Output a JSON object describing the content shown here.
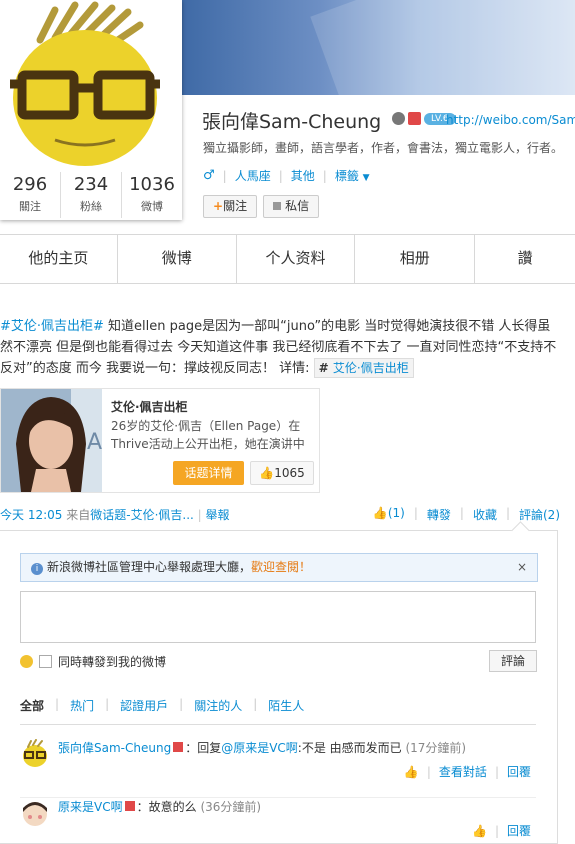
{
  "profile": {
    "name": "張向偉Sam-Cheung",
    "level": "LV.6",
    "url": "http://weibo.com/Sam",
    "bio": "獨立攝影師，畫師，語言學者，作者，會書法，獨立電影人，行者。",
    "gender": "♂",
    "location": "人馬座",
    "other": "其他",
    "tags_label": "標籤",
    "follow_label": "關注",
    "message_label": "私信",
    "stats": [
      {
        "num": "296",
        "label": "關注"
      },
      {
        "num": "234",
        "label": "粉絲"
      },
      {
        "num": "1036",
        "label": "微博"
      }
    ]
  },
  "tabs": [
    "他的主页",
    "微博",
    "个人资料",
    "相册",
    "讚"
  ],
  "post": {
    "hashtag": "#艾伦·佩吉出柜#",
    "text": " 知道ellen page是因为一部叫“juno”的电影 当时觉得她演技很不错 人长得虽然不漂亮 但是倒也能看得过去 今天知道这件事 我已经彻底看不下去了 一直对同性恋持“不支持不反对”的态度 而今 我要说一句：撑歧视反同志！ 详情: ",
    "tag_button": "艾伦·佩吉出柜",
    "card": {
      "title": "艾伦·佩吉出柜",
      "desc": "26岁的艾伦·佩吉（Ellen Page）在Thrive活动上公开出柜，她在演讲中",
      "detail_btn": "话题详情",
      "likes": "1065"
    },
    "time": "今天 12:05",
    "from_prefix": "来自",
    "from_source": "微话题-艾伦·佩吉...",
    "report": "舉報",
    "actions": {
      "like": "(1)",
      "forward": "轉發",
      "favorite": "收藏",
      "comment": "評論(2)"
    }
  },
  "comments": {
    "notice": "新浪微博社區管理中心舉報處理大廳，",
    "notice_link": "歡迎查閱！",
    "forward_label": "同時轉發到我的微博",
    "submit": "評論",
    "filters": [
      "全部",
      "热门",
      "認證用戶",
      "關注的人",
      "陌生人"
    ],
    "items": [
      {
        "user": "張向偉Sam-Cheung",
        "prefix": "：回复",
        "mention": "@原来是VC啊",
        "text": ":不是 由感而发而已",
        "time": "(17分鐘前)",
        "view": "查看對話",
        "reply": "回覆"
      },
      {
        "user": "原来是VC啊",
        "prefix": "：故意的么",
        "mention": "",
        "text": "",
        "time": "(36分鐘前)",
        "view": "",
        "reply": "回覆"
      }
    ]
  },
  "colors": {
    "link": "#0a8cd2",
    "orange": "#f5a623",
    "banner": "#6d8fc4"
  }
}
